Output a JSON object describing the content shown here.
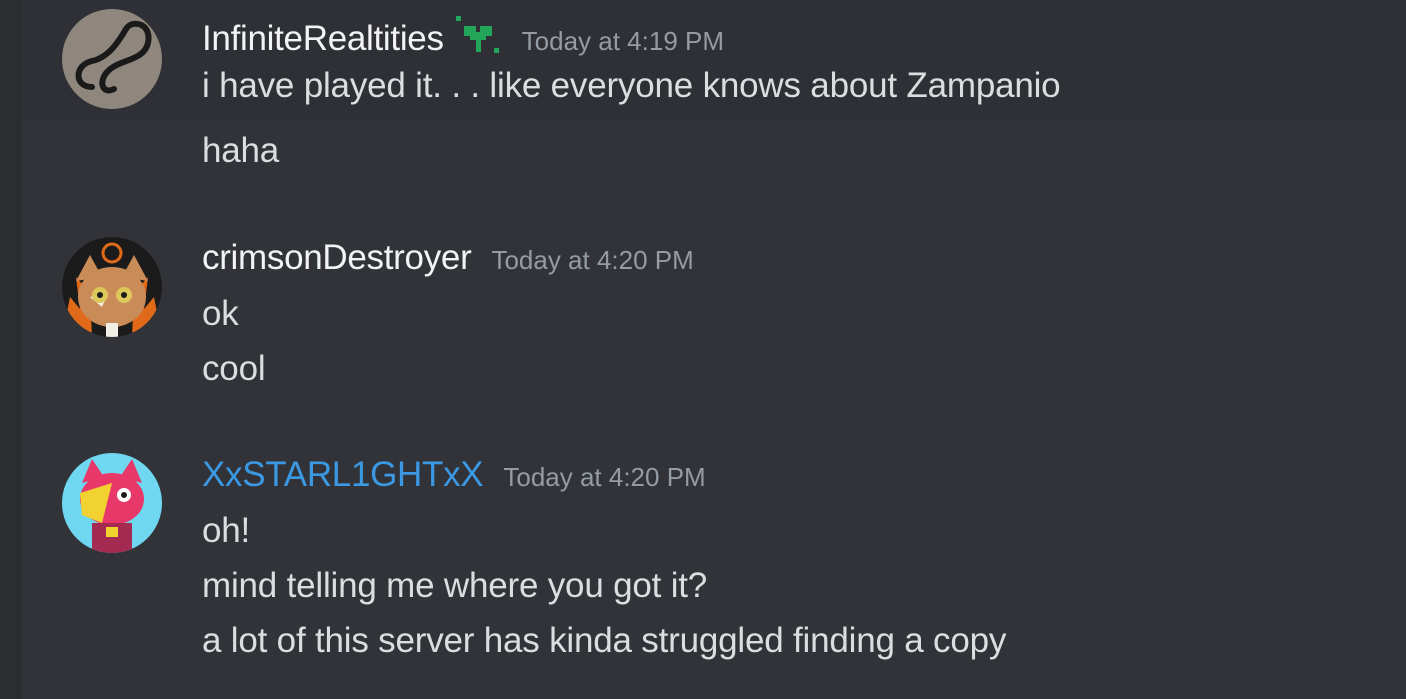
{
  "messages": [
    {
      "username": "InfiniteRealtities",
      "timestamp": "Today at 4:19 PM",
      "badge_icon": "green-sprout-icon",
      "lines": [
        "i have played it. . . like everyone knows about Zampanio",
        "haha"
      ]
    },
    {
      "username": "crimsonDestroyer",
      "timestamp": "Today at 4:20 PM",
      "lines": [
        "ok",
        "cool"
      ]
    },
    {
      "username": "XxSTARL1GHTxX",
      "username_color": "#3b98e3",
      "timestamp": "Today at 4:20 PM",
      "lines": [
        "oh!",
        "mind telling me where you got it?",
        "a lot of this server has kinda struggled finding a copy"
      ]
    }
  ],
  "colors": {
    "background": "#313338",
    "text": "#dbdee1",
    "timestamp": "#949ba4",
    "badge": "#23a55a"
  }
}
